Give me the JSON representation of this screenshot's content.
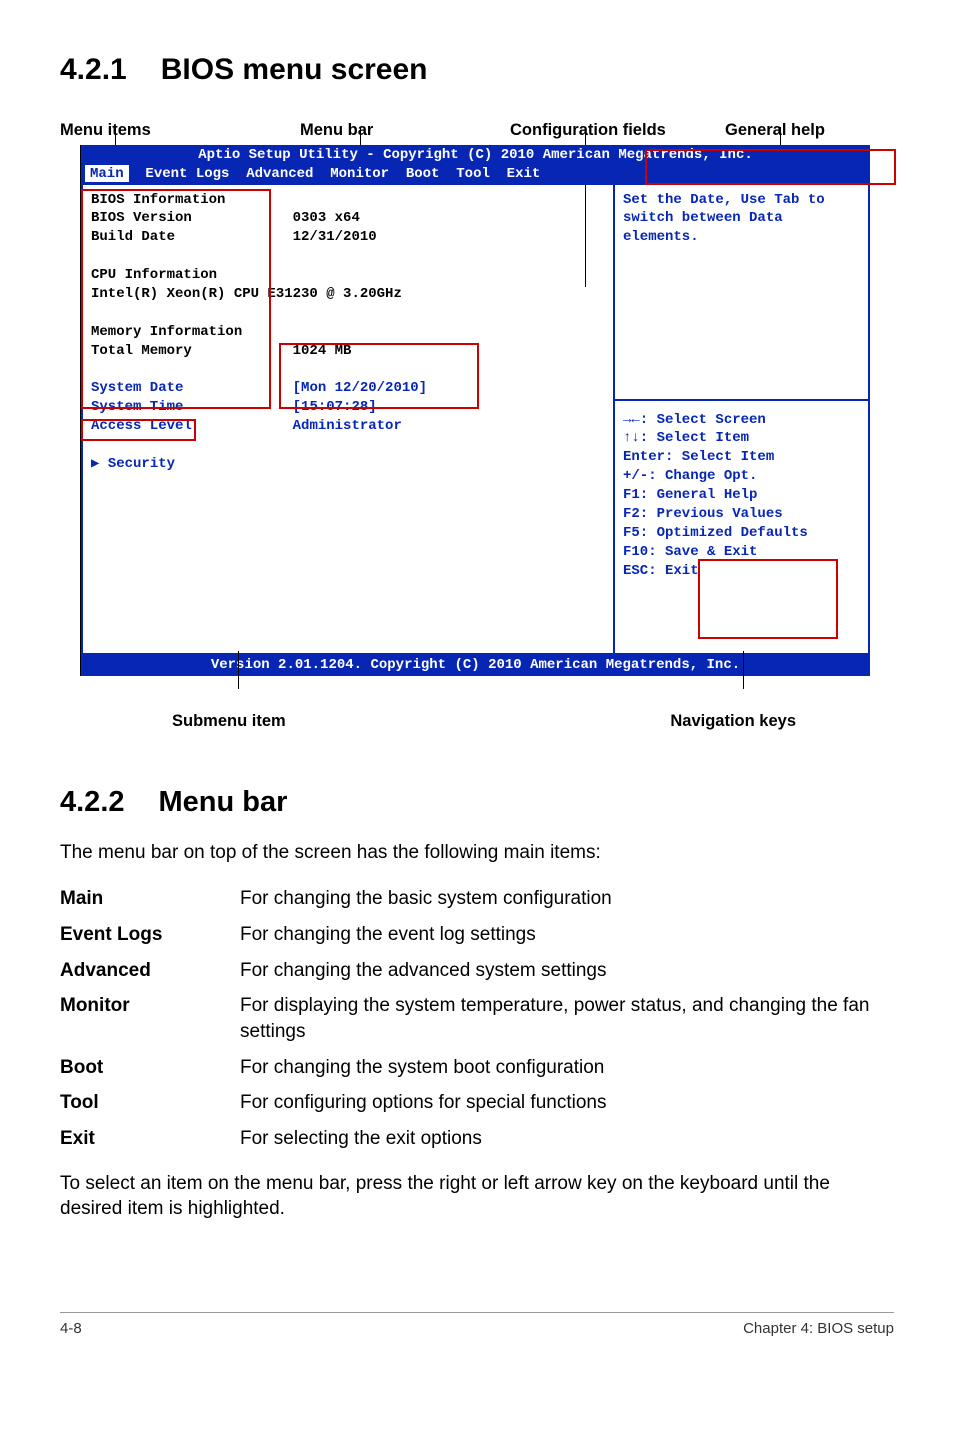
{
  "section1": {
    "num": "4.2.1",
    "title": "BIOS menu screen"
  },
  "top_labels": {
    "menu_items": "Menu items",
    "menu_bar": "Menu bar",
    "config_fields": "Configuration fields",
    "general_help": "General help"
  },
  "bios": {
    "title_line": "Aptio Setup Utility - Copyright (C) 2010 American Megatrends, Inc.",
    "menubar_selected": "Main",
    "menubar_rest": "  Event Logs  Advanced  Monitor  Boot  Tool  Exit",
    "left": {
      "l01": "BIOS Information",
      "l02": "BIOS Version            0303 x64",
      "l03": "Build Date              12/31/2010",
      "l05": "CPU Information",
      "l06": "Intel(R) Xeon(R) CPU E31230 @ 3.20GHz",
      "l08": "Memory Information",
      "l09": "Total Memory            1024 MB",
      "l11a": "System Date",
      "l11b": "             [Mon 12/20/2010]",
      "l12a": "System Time",
      "l12b": "             [15:07:28]",
      "l13a": "Access Level",
      "l13b": "            Administrator",
      "l15": "▶ Security"
    },
    "right_top1": "Set the Date, Use Tab to",
    "right_top2": "switch between Data elements.",
    "keys": {
      "k1": "→←: Select Screen",
      "k2": "↑↓:  Select Item",
      "k3": "Enter: Select Item",
      "k4": "+/-: Change Opt.",
      "k5": "F1: General Help",
      "k6": "F2: Previous Values",
      "k7": "F5: Optimized Defaults",
      "k8": "F10: Save & Exit",
      "k9": "ESC: Exit"
    },
    "footer": "Version 2.01.1204. Copyright (C) 2010 American Megatrends, Inc."
  },
  "bottom_labels": {
    "submenu_item": "Submenu item",
    "nav_keys": "Navigation keys"
  },
  "section2": {
    "num": "4.2.2",
    "title": "Menu bar"
  },
  "para1": "The menu bar on top of the screen has the following main items:",
  "table": [
    {
      "k": "Main",
      "v": "For changing the basic system configuration"
    },
    {
      "k": "Event Logs",
      "v": "For changing the event log settings"
    },
    {
      "k": "Advanced",
      "v": "For changing the advanced system settings"
    },
    {
      "k": "Monitor",
      "v": "For displaying the system temperature, power status, and changing the fan settings"
    },
    {
      "k": "Boot",
      "v": "For changing the system boot configuration"
    },
    {
      "k": "Tool",
      "v": "For configuring options for special functions"
    },
    {
      "k": "Exit",
      "v": "For selecting the exit options"
    }
  ],
  "para2": "To select an item on the menu bar, press the right or left arrow key on the keyboard until the desired item is highlighted.",
  "footer": {
    "page": "4-8",
    "chapter": "Chapter 4: BIOS setup"
  }
}
